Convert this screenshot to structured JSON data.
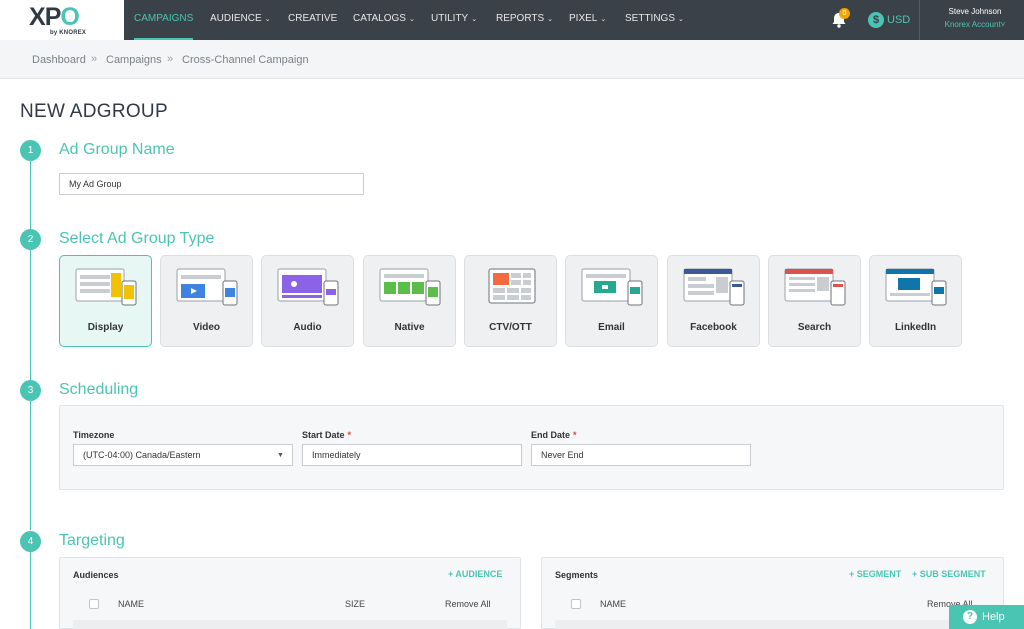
{
  "brand": {
    "logo_x": "X",
    "logo_p": "P",
    "logo_o": "O",
    "logo_sub": "by KNOREX"
  },
  "nav": {
    "items": [
      {
        "label": "CAMPAIGNS",
        "chevron": false
      },
      {
        "label": "AUDIENCE",
        "chevron": true
      },
      {
        "label": "CREATIVE",
        "chevron": false
      },
      {
        "label": "CATALOGS",
        "chevron": true
      },
      {
        "label": "UTILITY",
        "chevron": true
      },
      {
        "label": "REPORTS",
        "chevron": true
      },
      {
        "label": "PIXEL",
        "chevron": true
      },
      {
        "label": "SETTINGS",
        "chevron": true
      }
    ],
    "chevron_glyph": "⌄",
    "notification_count": "0",
    "currency_symbol": "$",
    "currency": "USD",
    "user_name": "Steve Johnson",
    "account": "Knorex Account˅"
  },
  "breadcrumb": {
    "items": [
      "Dashboard",
      "Campaigns",
      "Cross-Channel Campaign"
    ],
    "separator": "»"
  },
  "page": {
    "title": "NEW ADGROUP"
  },
  "steps": {
    "s1": {
      "num": "1",
      "title": "Ad Group Name"
    },
    "s2": {
      "num": "2",
      "title": "Select Ad Group Type"
    },
    "s3": {
      "num": "3",
      "title": "Scheduling"
    },
    "s4": {
      "num": "4",
      "title": "Targeting"
    }
  },
  "adgroup_name": {
    "value": "My Ad Group"
  },
  "adgroup_types": [
    {
      "label": "Display",
      "selected": true
    },
    {
      "label": "Video",
      "selected": false
    },
    {
      "label": "Audio",
      "selected": false
    },
    {
      "label": "Native",
      "selected": false
    },
    {
      "label": "CTV/OTT",
      "selected": false
    },
    {
      "label": "Email",
      "selected": false
    },
    {
      "label": "Facebook",
      "selected": false
    },
    {
      "label": "Search",
      "selected": false
    },
    {
      "label": "LinkedIn",
      "selected": false
    }
  ],
  "scheduling": {
    "timezone_label": "Timezone",
    "timezone_value": "(UTC-04:00) Canada/Eastern",
    "start_label": "Start Date",
    "start_value": "Immediately",
    "end_label": "End Date",
    "end_value": "Never End",
    "required_mark": "*"
  },
  "targeting": {
    "audiences": {
      "title": "Audiences",
      "add_link": "+ AUDIENCE",
      "col_name": "NAME",
      "col_size": "SIZE",
      "remove_all": "Remove All"
    },
    "segments": {
      "title": "Segments",
      "add_segment": "+ SEGMENT",
      "add_sub_segment": "+ SUB SEGMENT",
      "col_name": "NAME",
      "remove_all": "Remove All"
    }
  },
  "help": {
    "label": "Help",
    "glyph": "?"
  },
  "colors": {
    "accent": "#4bc5b3",
    "nav_bg": "#3b4148",
    "badge": "#f0a500"
  }
}
